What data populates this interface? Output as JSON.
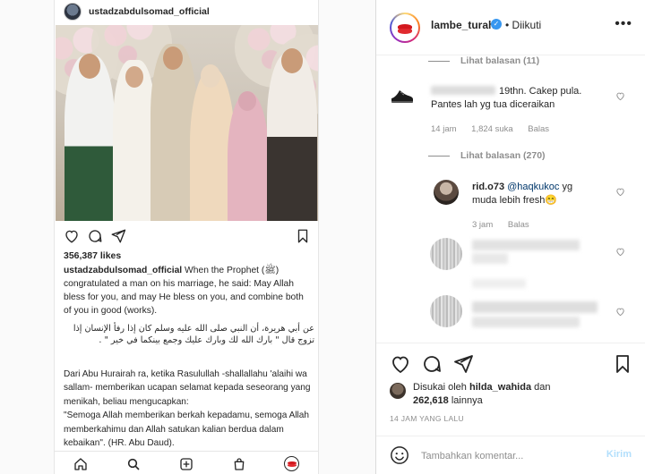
{
  "phone": {
    "username": "ustadzabdulsomad_official",
    "likes": "356,387 likes",
    "caption_user": "ustadzabdulsomad_official",
    "caption_text": "When the Prophet (ﷺ) congratulated a man on his marriage, he said: May Allah bless for you, and may He bless on you, and combine both of you in good (works).",
    "arabic": "عن أبي هريرة، أن النبي صلى الله عليه وسلم كان إذا رفأ الإنسان إذا تزوج قال \" بارك الله لك وبارك عليك وجمع بينكما في خير \" .",
    "indo_1": "Dari Abu Hurairah ra, ketika Rasulullah -shallallahu 'alaihi wa sallam- memberikan ucapan selamat kepada seseorang yang menikah, beliau mengucapkan:",
    "indo_2": "\"Semoga Allah memberikan berkah kepadamu, semoga Allah memberkahimu dan Allah satukan kalian berdua dalam kebaikan\". (HR. Abu Daud)."
  },
  "panel": {
    "username": "lambe_turah",
    "verified": "✓",
    "follow": "• Diikuti",
    "more": "•••",
    "replies_1": "Lihat balasan (11)",
    "comment_1": {
      "text": "19thn. Cakep pula. Pantes lah yg tua diceraikan",
      "time": "14 jam",
      "likes": "1,824 suka",
      "reply": "Balas"
    },
    "replies_2": "Lihat balasan (270)",
    "comment_2": {
      "user": "rid.o73",
      "mention": "@haqkukoc",
      "text": " yg muda lebih fresh😁",
      "time": "3 jam",
      "reply": "Balas"
    },
    "liked_prefix": "Disukai oleh",
    "liked_user": "hilda_wahida",
    "liked_and": "dan",
    "liked_count": "262,618",
    "liked_suffix": "lainnya",
    "time_ago": "14 JAM YANG LALU",
    "comment_placeholder": "Tambahkan komentar...",
    "post_label": "Kirim"
  }
}
